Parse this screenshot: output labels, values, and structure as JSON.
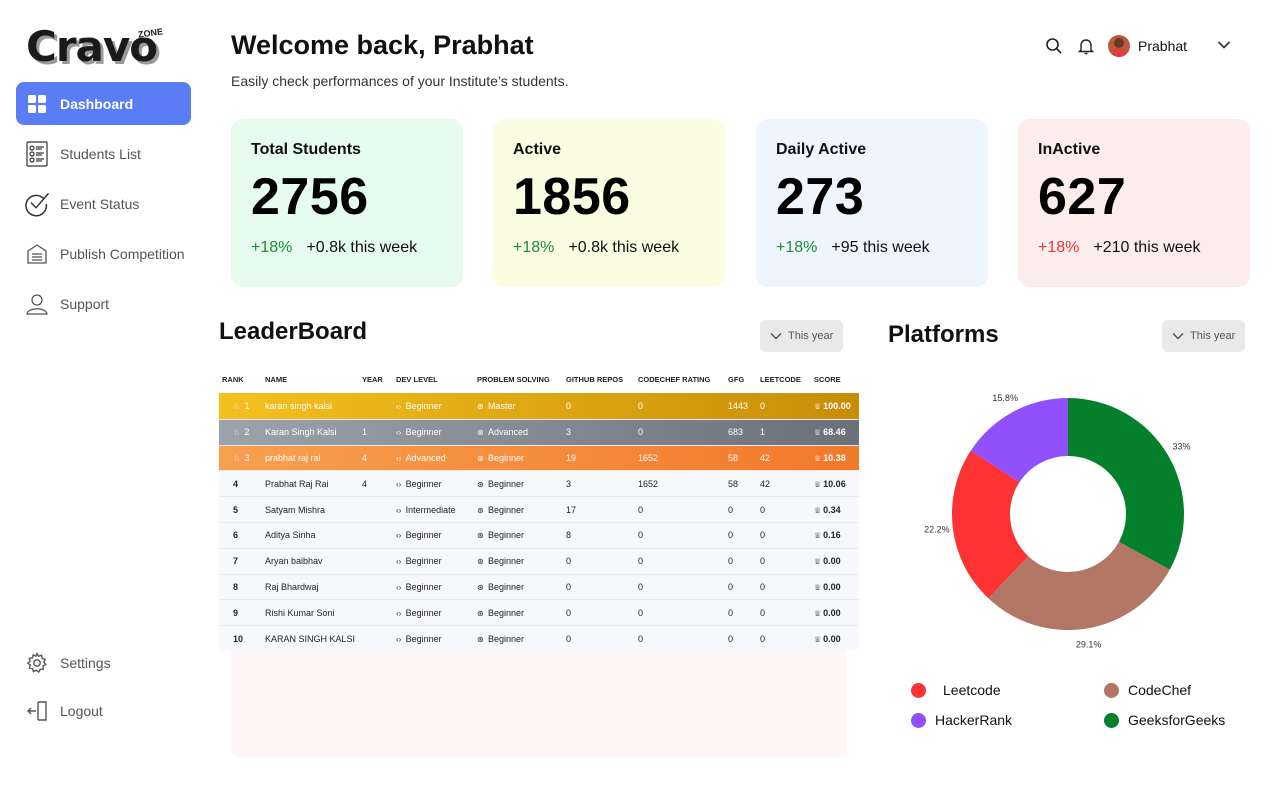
{
  "logo": {
    "text": "Cravo",
    "badge": "ZONE"
  },
  "sidebar": {
    "items": [
      {
        "label": "Dashboard",
        "icon": "grid-icon",
        "active": true
      },
      {
        "label": "Students List",
        "icon": "list-icon"
      },
      {
        "label": "Event Status",
        "icon": "check-circle-icon"
      },
      {
        "label": "Publish Competition",
        "icon": "building-icon"
      },
      {
        "label": "Support",
        "icon": "user-icon"
      }
    ],
    "bottom": [
      {
        "label": "Settings",
        "icon": "gear-icon"
      },
      {
        "label": "Logout",
        "icon": "logout-icon"
      }
    ]
  },
  "header": {
    "title": "Welcome back, Prabhat",
    "subtitle": "Easily check performances of your Institute’s students.",
    "user": "Prabhat"
  },
  "cards": [
    {
      "title": "Total Students",
      "value": "2756",
      "pct": "+18%",
      "week": "+0.8k this week",
      "bg": "#e6fcee",
      "pct_color": "#1f8a3b"
    },
    {
      "title": "Active",
      "value": "1856",
      "pct": "+18%",
      "week": "+0.8k this week",
      "bg": "#fafde2",
      "pct_color": "#1f8a3b"
    },
    {
      "title": "Daily Active",
      "value": "273",
      "pct": "+18%",
      "week": "+95 this week",
      "bg": "#eef5fd",
      "pct_color": "#1f8a3b"
    },
    {
      "title": "InActive",
      "value": "627",
      "pct": "+18%",
      "week": "+210 this week",
      "bg": "#fdecec",
      "pct_color": "#e23b3b"
    }
  ],
  "leaderboard": {
    "title": "LeaderBoard",
    "filter": "This year",
    "columns": [
      "RANK",
      "NAME",
      "YEAR",
      "DEV LEVEL",
      "PROBLEM SOLVING",
      "GITHUB REPOS",
      "CODECHEF RATING",
      "GFG",
      "LEETCODE",
      "SCORE"
    ],
    "rows": [
      {
        "rank": "1",
        "name": "karan singh kalsi",
        "year": "",
        "dev": "Beginner",
        "ps": "Master",
        "gh": "0",
        "cc": "0",
        "gfg": "1443",
        "lc": "0",
        "score": "100.00"
      },
      {
        "rank": "2",
        "name": "Karan Singh Kalsi",
        "year": "1",
        "dev": "Beginner",
        "ps": "Advanced",
        "gh": "3",
        "cc": "0",
        "gfg": "683",
        "lc": "1",
        "score": "68.46"
      },
      {
        "rank": "3",
        "name": "prabhat raj rai",
        "year": "4",
        "dev": "Advanced",
        "ps": "Beginner",
        "gh": "19",
        "cc": "1652",
        "gfg": "58",
        "lc": "42",
        "score": "10.38"
      },
      {
        "rank": "4",
        "name": "Prabhat Raj Rai",
        "year": "4",
        "dev": "Beginner",
        "ps": "Beginner",
        "gh": "3",
        "cc": "1652",
        "gfg": "58",
        "lc": "42",
        "score": "10.06"
      },
      {
        "rank": "5",
        "name": "Satyam Mishra",
        "year": "",
        "dev": "Intermediate",
        "ps": "Beginner",
        "gh": "17",
        "cc": "0",
        "gfg": "0",
        "lc": "0",
        "score": "0.34"
      },
      {
        "rank": "6",
        "name": "Aditya Sinha",
        "year": "",
        "dev": "Beginner",
        "ps": "Beginner",
        "gh": "8",
        "cc": "0",
        "gfg": "0",
        "lc": "0",
        "score": "0.16"
      },
      {
        "rank": "7",
        "name": "Aryan baibhav",
        "year": "",
        "dev": "Beginner",
        "ps": "Beginner",
        "gh": "0",
        "cc": "0",
        "gfg": "0",
        "lc": "0",
        "score": "0.00"
      },
      {
        "rank": "8",
        "name": "Raj Bhardwaj",
        "year": "",
        "dev": "Beginner",
        "ps": "Beginner",
        "gh": "0",
        "cc": "0",
        "gfg": "0",
        "lc": "0",
        "score": "0.00"
      },
      {
        "rank": "9",
        "name": "Rishi Kumar Soni",
        "year": "",
        "dev": "Beginner",
        "ps": "Beginner",
        "gh": "0",
        "cc": "0",
        "gfg": "0",
        "lc": "0",
        "score": "0.00"
      },
      {
        "rank": "10",
        "name": "KARAN SINGH KALSI",
        "year": "",
        "dev": "Beginner",
        "ps": "Beginner",
        "gh": "0",
        "cc": "0",
        "gfg": "0",
        "lc": "0",
        "score": "0.00"
      }
    ]
  },
  "platforms": {
    "title": "Platforms",
    "filter": "This year"
  },
  "chart_data": {
    "type": "pie",
    "donut": true,
    "categories": [
      "GeeksforGeeks",
      "CodeChef",
      "Leetcode",
      "HackerRank"
    ],
    "values": [
      33,
      29.1,
      22.2,
      15.8
    ],
    "labels": [
      "33%",
      "29.1%",
      "22.2%",
      "15.8%"
    ],
    "colors": [
      "#047f2b",
      "#b27665",
      "#fc3233",
      "#9150fd"
    ],
    "legend": [
      {
        "name": "Leetcode",
        "color": "#fc3233"
      },
      {
        "name": "CodeChef",
        "color": "#b27665"
      },
      {
        "name": "HackerRank",
        "color": "#9150fd"
      },
      {
        "name": "GeeksforGeeks",
        "color": "#047f2b"
      }
    ],
    "legend_position": "bottom"
  }
}
